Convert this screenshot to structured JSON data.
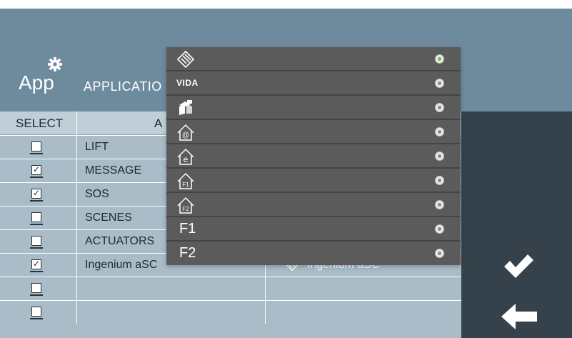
{
  "header": {
    "app_title": "App",
    "subtitle": "APPLICATIO",
    "icon": "gear-icon",
    "bg_color": "#6e8a9d"
  },
  "table": {
    "columns": [
      "SELECT",
      "A"
    ],
    "rows": [
      {
        "checked": false,
        "name": "LIFT",
        "assigned": ""
      },
      {
        "checked": true,
        "name": "MESSAGE",
        "assigned": ""
      },
      {
        "checked": true,
        "name": "SOS",
        "assigned": ""
      },
      {
        "checked": false,
        "name": "SCENES",
        "assigned": ""
      },
      {
        "checked": false,
        "name": "ACTUATORS",
        "assigned": ""
      },
      {
        "checked": true,
        "name": "Ingenium aSC",
        "assigned": "Ingenium aSC",
        "assigned_icon": "ingenium-icon"
      },
      {
        "checked": false,
        "name": "",
        "assigned": ""
      },
      {
        "checked": false,
        "name": "",
        "assigned": ""
      }
    ]
  },
  "dropdown": {
    "options": [
      {
        "icon": "ingenium-icon",
        "label": "",
        "selected": true
      },
      {
        "icon": "vida-logo",
        "label": "VIDA",
        "selected": false
      },
      {
        "icon": "cube-icon",
        "label": "",
        "selected": false
      },
      {
        "icon": "house-at-icon",
        "label": "@",
        "selected": false
      },
      {
        "icon": "house-e-icon",
        "label": "e",
        "selected": false
      },
      {
        "icon": "house-f1-icon",
        "label": "F1",
        "selected": false
      },
      {
        "icon": "house-f2-icon",
        "label": "F2",
        "selected": false
      },
      {
        "icon": "",
        "label": "F1",
        "selected": false
      },
      {
        "icon": "",
        "label": "F2",
        "selected": false
      }
    ],
    "selected_color": "#6cc04a"
  },
  "actions": {
    "confirm_icon": "check-icon",
    "back_icon": "arrow-left-icon"
  }
}
